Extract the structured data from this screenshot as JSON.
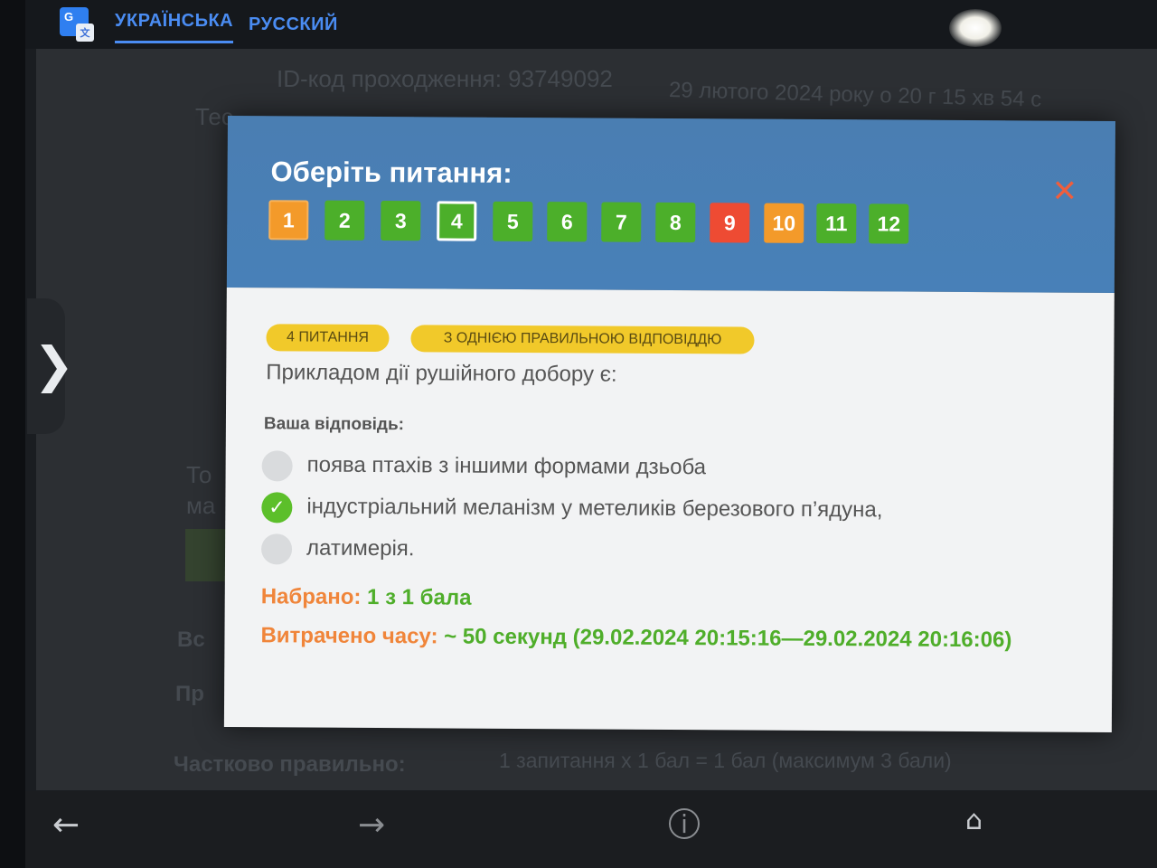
{
  "top_bar": {
    "translate_icon": "google-translate-icon",
    "tabs": [
      {
        "label": "УКРАЇНСЬКА",
        "active": true
      },
      {
        "label": "РУССКИЙ",
        "active": false
      }
    ]
  },
  "background_page": {
    "pass_id": "ID-код проходження: 93749092",
    "date": "29 лютого 2024 року о 20 г 15 хв 54 с",
    "test_label": "Тес",
    "left_fragment_1": "То",
    "left_fragment_2": "ма",
    "all_label": "Вс",
    "correct_label": "Пр",
    "partial_label": "Частково правильно:",
    "partial_value": "1 запитання х 1 бал = 1 бал (максимум 3 бали)"
  },
  "modal": {
    "title": "Оберіть питання:",
    "close_icon": "close-icon",
    "questions": [
      {
        "label": "1",
        "status": "partial"
      },
      {
        "label": "2",
        "status": "correct"
      },
      {
        "label": "3",
        "status": "correct"
      },
      {
        "label": "4",
        "status": "current"
      },
      {
        "label": "5",
        "status": "correct"
      },
      {
        "label": "6",
        "status": "correct"
      },
      {
        "label": "7",
        "status": "correct"
      },
      {
        "label": "8",
        "status": "correct"
      },
      {
        "label": "9",
        "status": "wrong"
      },
      {
        "label": "10",
        "status": "partial"
      },
      {
        "label": "11",
        "status": "correct"
      },
      {
        "label": "12",
        "status": "correct"
      }
    ],
    "badge_question": "4 ПИТАННЯ",
    "badge_type": "З ОДНІЄЮ ПРАВИЛЬНОЮ ВІДПОВІДДЮ",
    "question_text": "Прикладом дії рушійного добору є:",
    "answer_label": "Ваша відповідь:",
    "options": [
      {
        "text": "поява птахів з іншими формами дзьоба",
        "selected": false
      },
      {
        "text": "індустріальний меланізм у метеликів березового п’ядуна,",
        "selected": true
      },
      {
        "text": "латимерія.",
        "selected": false
      }
    ],
    "score_label": "Набрано:",
    "score_value": "1 з 1 бала",
    "time_label": "Витрачено часу:",
    "time_value": "~ 50 секунд (29.02.2024 20:15:16—29.02.2024 20:16:06)"
  },
  "colors": {
    "header_blue": "#4a7eb2",
    "correct_green": "#4caf2a",
    "partial_orange": "#f39a2a",
    "wrong_red": "#ee4b33",
    "badge_yellow": "#f1c92a",
    "label_orange": "#f0853a"
  },
  "bottom_nav": {
    "back_icon": "arrow-left-icon",
    "forward_icon": "arrow-right-icon",
    "info_icon": "info-icon",
    "home_icon": "home-icon"
  }
}
